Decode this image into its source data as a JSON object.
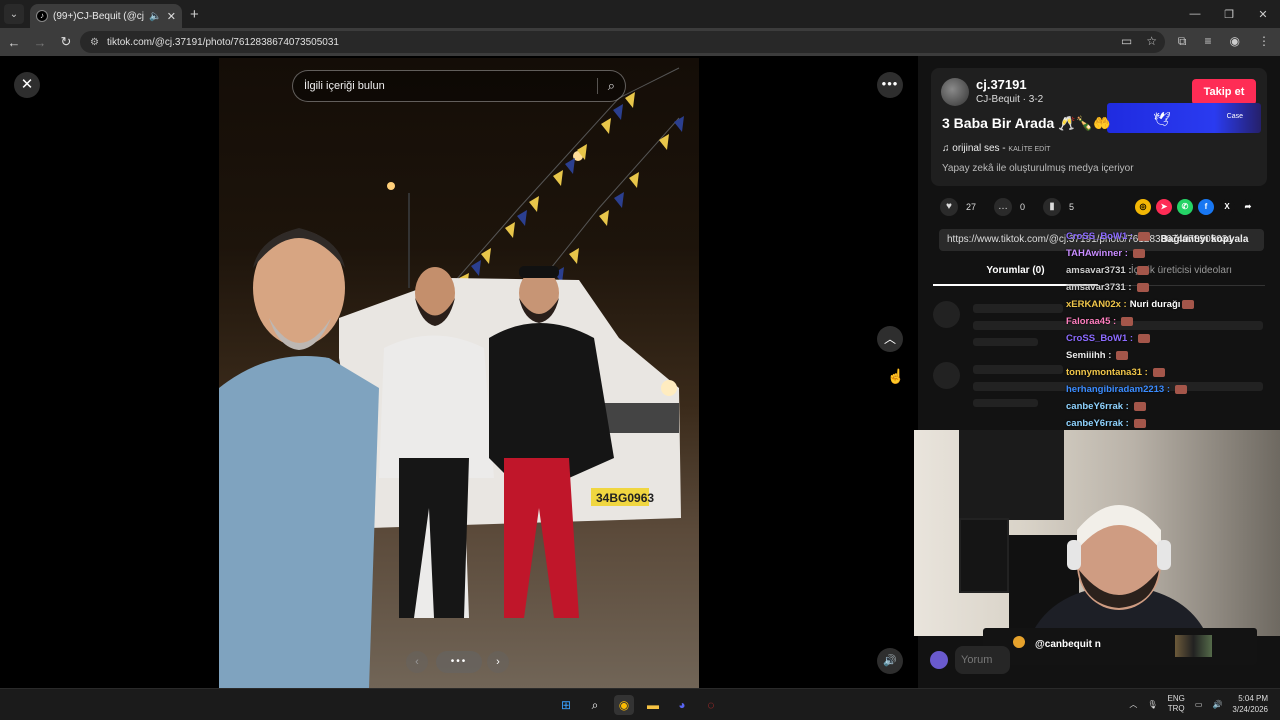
{
  "browser": {
    "tab_title": "(99+)CJ-Bequit (@cj.37191) | TikTok",
    "tab_close": "✕",
    "new_tab": "+",
    "url": "tiktok.com/@cj.37191/photo/7612838674073505031",
    "window_controls": [
      "—",
      "❐",
      "✕"
    ]
  },
  "viewer": {
    "search_placeholder": "İlgili içeriği bulun",
    "close_label": "✕",
    "more_label": "•••",
    "up_label": "︿",
    "volume_label": "🔊",
    "pager_dots": "•••",
    "prev_label": "‹",
    "next_label": "›"
  },
  "panel": {
    "username": "cj.37191",
    "subtitle": "CJ-Bequit · 3-2",
    "follow_label": "Takip et",
    "ad_brand": "Case",
    "title": "3 Baba Bir Arada 🥂🍾🤲",
    "music": "orijinal ses - ",
    "music_tag": "KALİTE EDİT",
    "ai_note": "Yapay zekâ ile oluşturulmuş medya içeriyor",
    "likes": "27",
    "comments_count": "0",
    "saves": "5",
    "link": "https://www.tiktok.com/@cj.37191/photo/7612838674073505031",
    "copy_link": "Bağlantıyı kopyala",
    "tab_comments": "Yorumlar (0)",
    "tab_more": "İçerik üreticisi videoları",
    "comment_placeholder": "Yorum ekle..."
  },
  "stream_chat": [
    {
      "user": "CroSS_BoW1 :",
      "msg": "",
      "color": "#8c6bff"
    },
    {
      "user": "TAHAwinner :",
      "msg": "",
      "color": "#c88cff"
    },
    {
      "user": "amsavar3731 :",
      "msg": "",
      "color": "#cfcfcf"
    },
    {
      "user": "amsavar3731 :",
      "msg": "",
      "color": "#cfcfcf"
    },
    {
      "user": "xERKAN02x :",
      "msg": "Nuri durağı",
      "color": "#f0c64a"
    },
    {
      "user": "Faloraa45 :",
      "msg": "",
      "color": "#ff7fbf"
    },
    {
      "user": "CroSS_BoW1 :",
      "msg": "",
      "color": "#8c6bff"
    },
    {
      "user": "Semiiihh :",
      "msg": "",
      "color": "#eaeaea"
    },
    {
      "user": "tonnymontana31 :",
      "msg": "",
      "color": "#f0c64a"
    },
    {
      "user": "herhangibiradam2213 :",
      "msg": "",
      "color": "#3b8cff"
    },
    {
      "user": "canbeY6rrak :",
      "msg": "",
      "color": "#8fd3ff"
    },
    {
      "user": "canbeY6rrak :",
      "msg": "",
      "color": "#8fd3ff"
    }
  ],
  "stream_overlay": {
    "handle": "@canbequit n"
  },
  "taskbar": {
    "language_top": "ENG",
    "language_bottom": "TRQ",
    "time": "5:04 PM",
    "date": "3/24/2026"
  },
  "colors": {
    "accent": "#fe2c55",
    "panel_bg": "#121212",
    "card_bg": "#1f1f1f"
  }
}
